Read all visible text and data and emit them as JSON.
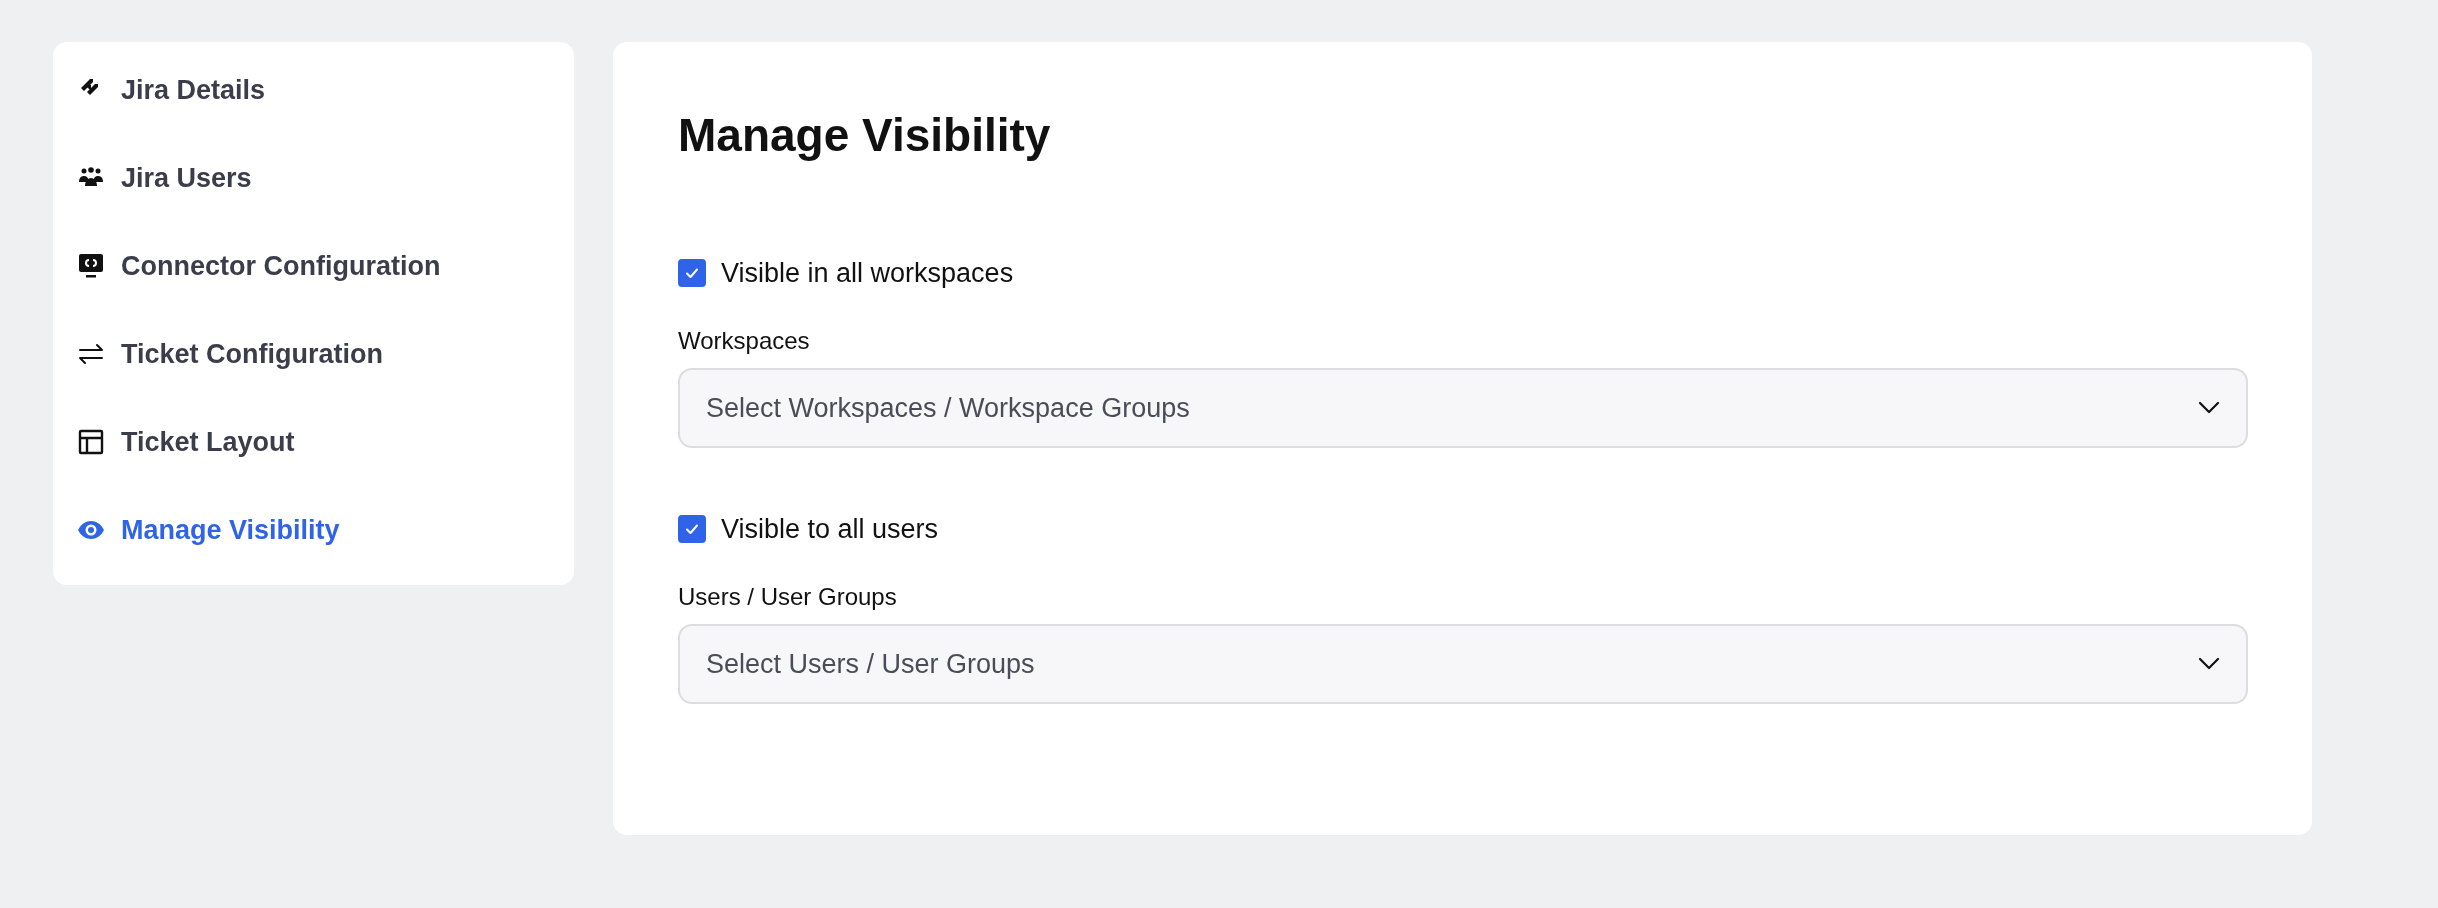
{
  "sidebar": {
    "items": [
      {
        "label": "Jira Details",
        "selected": false
      },
      {
        "label": "Jira Users",
        "selected": false
      },
      {
        "label": "Connector Configuration",
        "selected": false
      },
      {
        "label": "Ticket Configuration",
        "selected": false
      },
      {
        "label": "Ticket Layout",
        "selected": false
      },
      {
        "label": "Manage Visibility",
        "selected": true
      }
    ]
  },
  "main": {
    "title": "Manage Visibility",
    "sections": [
      {
        "checkbox": {
          "label": "Visible in all workspaces",
          "checked": true
        },
        "field": {
          "label": "Workspaces",
          "placeholder": "Select Workspaces / Workspace Groups"
        }
      },
      {
        "checkbox": {
          "label": "Visible to all users",
          "checked": true
        },
        "field": {
          "label": "Users / User Groups",
          "placeholder": "Select Users / User Groups"
        }
      }
    ]
  }
}
